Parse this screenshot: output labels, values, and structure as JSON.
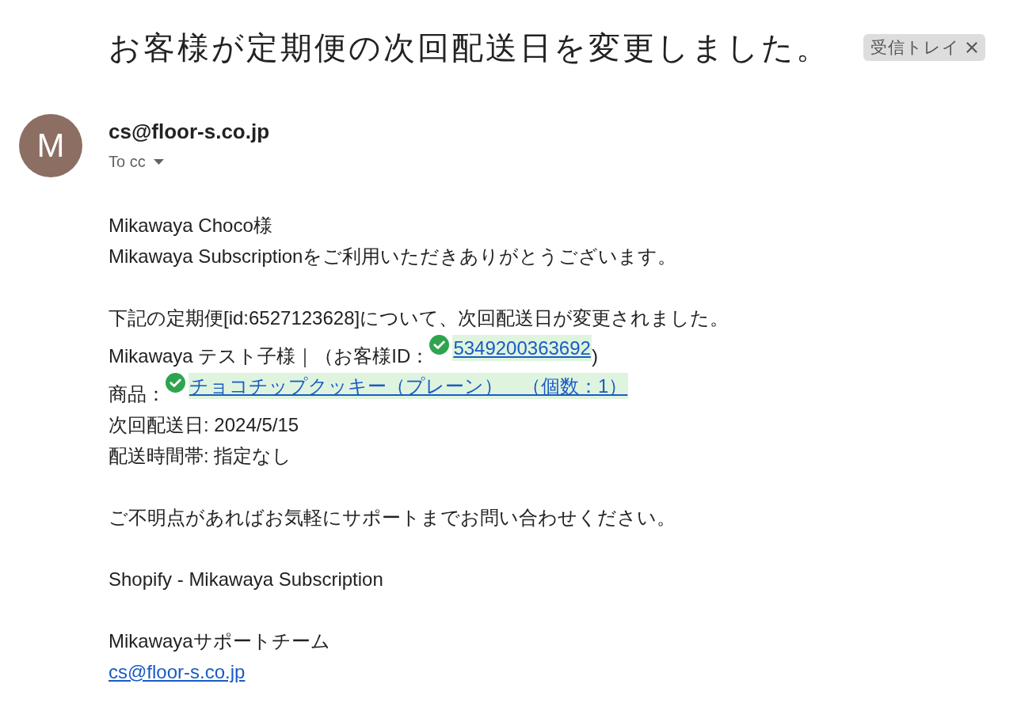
{
  "subject": "お客様が定期便の次回配送日を変更しました。",
  "label": "受信トレイ",
  "sender": {
    "initial": "M",
    "email": "cs@floor-s.co.jp",
    "recipients": "To cc"
  },
  "body": {
    "paragraphs": [
      {
        "lines": [
          {
            "kind": "text",
            "text": "Mikawaya Choco様"
          },
          {
            "kind": "text",
            "text": "Mikawaya Subscriptionをご利用いただきありがとうございます。"
          }
        ]
      },
      {
        "lines": [
          {
            "kind": "text",
            "text": "下記の定期便[id:6527123628]について、次回配送日が変更されました。"
          },
          {
            "kind": "linked",
            "prefix": "Mikawaya テスト子様｜（お客様ID：",
            "link": "5349200363692",
            "suffix": ")",
            "verified": true
          },
          {
            "kind": "linked",
            "prefix": "商品：",
            "link": "チョコチップクッキー（プレーン）　（個数：1）",
            "verified": true
          },
          {
            "kind": "text",
            "text": "次回配送日: 2024/5/15"
          },
          {
            "kind": "text",
            "text": "配送時間帯: 指定なし"
          }
        ]
      },
      {
        "lines": [
          {
            "kind": "text",
            "text": "ご不明点があればお気軽にサポートまでお問い合わせください。"
          }
        ]
      },
      {
        "lines": [
          {
            "kind": "text",
            "text": "Shopify - Mikawaya Subscription"
          }
        ]
      },
      {
        "lines": [
          {
            "kind": "text",
            "text": "Mikawayaサポートチーム"
          },
          {
            "kind": "link",
            "text": "cs@floor-s.co.jp"
          }
        ]
      }
    ]
  }
}
